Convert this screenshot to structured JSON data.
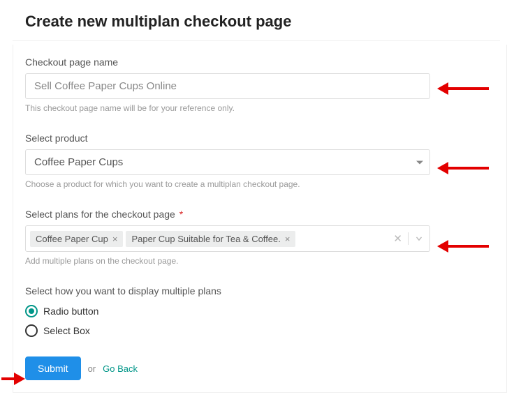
{
  "title": "Create new multiplan checkout page",
  "checkout_name": {
    "label": "Checkout page name",
    "value": "Sell Coffee Paper Cups Online",
    "helper": "This checkout page name will be for your reference only."
  },
  "product": {
    "label": "Select product",
    "selected": "Coffee Paper Cups",
    "helper": "Choose a product for which you want to create a multiplan checkout page."
  },
  "plans": {
    "label": "Select plans for the checkout page",
    "required_mark": "*",
    "tags": [
      "Coffee Paper Cup",
      "Paper Cup Suitable for Tea & Coffee."
    ],
    "tag_remove": "×",
    "helper": "Add multiple plans on the checkout page."
  },
  "display": {
    "label": "Select how you want to display multiple plans",
    "options": [
      {
        "label": "Radio button",
        "selected": true
      },
      {
        "label": "Select Box",
        "selected": false
      }
    ]
  },
  "actions": {
    "submit": "Submit",
    "or": "or",
    "go_back": "Go Back"
  }
}
